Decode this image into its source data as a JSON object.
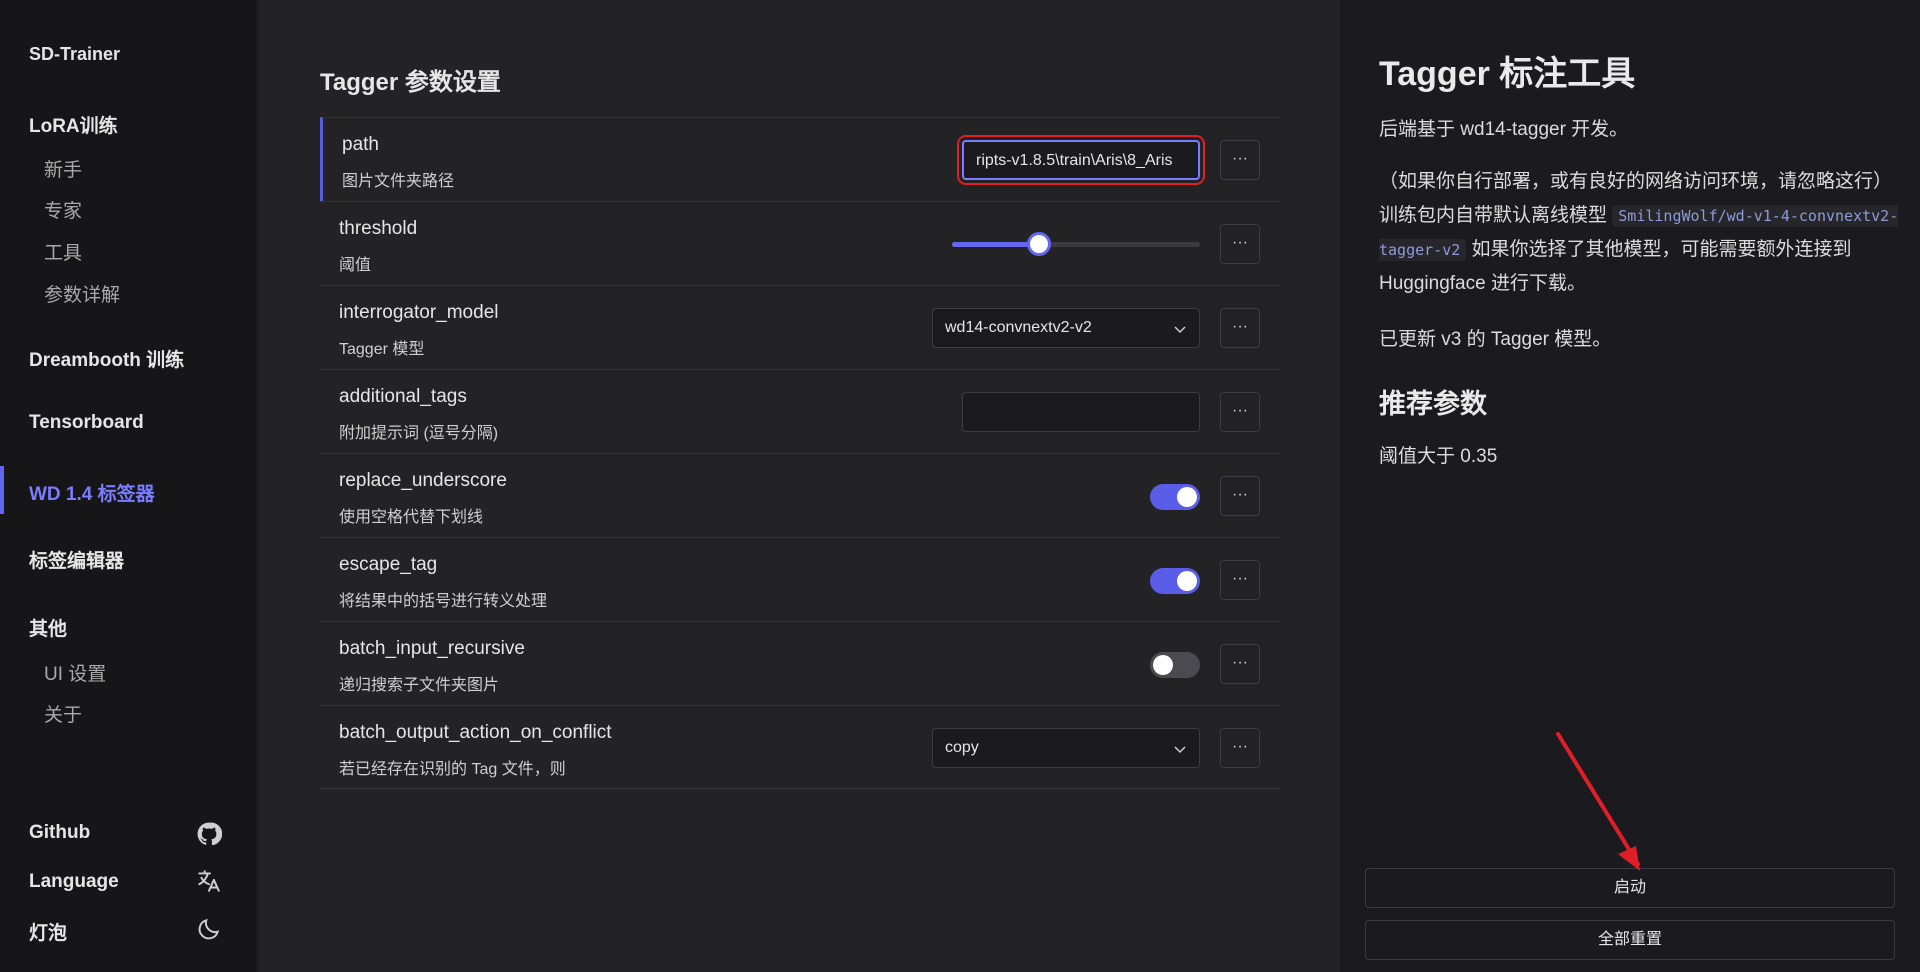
{
  "sidebar": {
    "brand": "SD-Trainer",
    "groups": [
      {
        "label": "LoRA训练",
        "items": [
          "新手",
          "专家",
          "工具",
          "参数详解"
        ]
      },
      {
        "label": "Dreambooth 训练"
      },
      {
        "label": "Tensorboard"
      },
      {
        "label": "WD 1.4 标签器",
        "active": true
      },
      {
        "label": "标签编辑器"
      },
      {
        "label": "其他",
        "items": [
          "UI 设置",
          "关于"
        ]
      }
    ],
    "footer": [
      {
        "label": "Github",
        "icon": "github-icon"
      },
      {
        "label": "Language",
        "icon": "translate-icon"
      },
      {
        "label": "灯泡",
        "icon": "moon-icon"
      }
    ]
  },
  "main": {
    "title": "Tagger 参数设置",
    "rows": [
      {
        "name": "path",
        "desc": "图片文件夹路径",
        "control": "text",
        "value": "ripts-v1.8.5\\train\\Aris\\8_Aris"
      },
      {
        "name": "threshold",
        "desc": "阈值",
        "control": "slider",
        "value": 0.35
      },
      {
        "name": "interrogator_model",
        "desc": "Tagger 模型",
        "control": "select",
        "value": "wd14-convnextv2-v2"
      },
      {
        "name": "additional_tags",
        "desc": "附加提示词 (逗号分隔)",
        "control": "text",
        "value": ""
      },
      {
        "name": "replace_underscore",
        "desc": "使用空格代替下划线",
        "control": "toggle",
        "value": true
      },
      {
        "name": "escape_tag",
        "desc": "将结果中的括号进行转义处理",
        "control": "toggle",
        "value": true
      },
      {
        "name": "batch_input_recursive",
        "desc": "递归搜索子文件夹图片",
        "control": "toggle",
        "value": false
      },
      {
        "name": "batch_output_action_on_conflict",
        "desc": "若已经存在识别的 Tag 文件，则",
        "control": "select",
        "value": "copy"
      }
    ],
    "more_label": "···"
  },
  "right": {
    "title": "Tagger 标注工具",
    "p1": "后端基于 wd14-tagger 开发。",
    "p2_a": "（如果你自行部署，或有良好的网络访问环境，请忽略这行）训练包内自带默认离线模型 ",
    "p2_code": "SmilingWolf/wd-v1-4-convnextv2-tagger-v2",
    "p2_b": " 如果你选择了其他模型，可能需要额外连接到 Huggingface 进行下载。",
    "p3": "已更新 v3 的 Tagger 模型。",
    "h2": "推荐参数",
    "p4": "阈值大于 0.35",
    "start_label": "启动",
    "reset_label": "全部重置"
  },
  "colors": {
    "accent": "#6366f1",
    "highlight": "#e11d28"
  }
}
